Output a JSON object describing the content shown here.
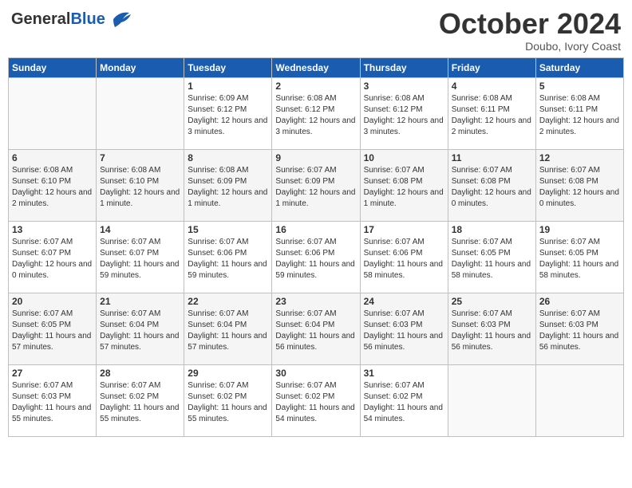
{
  "logo": {
    "text_general": "General",
    "text_blue": "Blue"
  },
  "title": "October 2024",
  "location": "Doubo, Ivory Coast",
  "days_of_week": [
    "Sunday",
    "Monday",
    "Tuesday",
    "Wednesday",
    "Thursday",
    "Friday",
    "Saturday"
  ],
  "weeks": [
    [
      {
        "day": "",
        "info": ""
      },
      {
        "day": "",
        "info": ""
      },
      {
        "day": "1",
        "info": "Sunrise: 6:09 AM\nSunset: 6:12 PM\nDaylight: 12 hours and 3 minutes."
      },
      {
        "day": "2",
        "info": "Sunrise: 6:08 AM\nSunset: 6:12 PM\nDaylight: 12 hours and 3 minutes."
      },
      {
        "day": "3",
        "info": "Sunrise: 6:08 AM\nSunset: 6:12 PM\nDaylight: 12 hours and 3 minutes."
      },
      {
        "day": "4",
        "info": "Sunrise: 6:08 AM\nSunset: 6:11 PM\nDaylight: 12 hours and 2 minutes."
      },
      {
        "day": "5",
        "info": "Sunrise: 6:08 AM\nSunset: 6:11 PM\nDaylight: 12 hours and 2 minutes."
      }
    ],
    [
      {
        "day": "6",
        "info": "Sunrise: 6:08 AM\nSunset: 6:10 PM\nDaylight: 12 hours and 2 minutes."
      },
      {
        "day": "7",
        "info": "Sunrise: 6:08 AM\nSunset: 6:10 PM\nDaylight: 12 hours and 1 minute."
      },
      {
        "day": "8",
        "info": "Sunrise: 6:08 AM\nSunset: 6:09 PM\nDaylight: 12 hours and 1 minute."
      },
      {
        "day": "9",
        "info": "Sunrise: 6:07 AM\nSunset: 6:09 PM\nDaylight: 12 hours and 1 minute."
      },
      {
        "day": "10",
        "info": "Sunrise: 6:07 AM\nSunset: 6:08 PM\nDaylight: 12 hours and 1 minute."
      },
      {
        "day": "11",
        "info": "Sunrise: 6:07 AM\nSunset: 6:08 PM\nDaylight: 12 hours and 0 minutes."
      },
      {
        "day": "12",
        "info": "Sunrise: 6:07 AM\nSunset: 6:08 PM\nDaylight: 12 hours and 0 minutes."
      }
    ],
    [
      {
        "day": "13",
        "info": "Sunrise: 6:07 AM\nSunset: 6:07 PM\nDaylight: 12 hours and 0 minutes."
      },
      {
        "day": "14",
        "info": "Sunrise: 6:07 AM\nSunset: 6:07 PM\nDaylight: 11 hours and 59 minutes."
      },
      {
        "day": "15",
        "info": "Sunrise: 6:07 AM\nSunset: 6:06 PM\nDaylight: 11 hours and 59 minutes."
      },
      {
        "day": "16",
        "info": "Sunrise: 6:07 AM\nSunset: 6:06 PM\nDaylight: 11 hours and 59 minutes."
      },
      {
        "day": "17",
        "info": "Sunrise: 6:07 AM\nSunset: 6:06 PM\nDaylight: 11 hours and 58 minutes."
      },
      {
        "day": "18",
        "info": "Sunrise: 6:07 AM\nSunset: 6:05 PM\nDaylight: 11 hours and 58 minutes."
      },
      {
        "day": "19",
        "info": "Sunrise: 6:07 AM\nSunset: 6:05 PM\nDaylight: 11 hours and 58 minutes."
      }
    ],
    [
      {
        "day": "20",
        "info": "Sunrise: 6:07 AM\nSunset: 6:05 PM\nDaylight: 11 hours and 57 minutes."
      },
      {
        "day": "21",
        "info": "Sunrise: 6:07 AM\nSunset: 6:04 PM\nDaylight: 11 hours and 57 minutes."
      },
      {
        "day": "22",
        "info": "Sunrise: 6:07 AM\nSunset: 6:04 PM\nDaylight: 11 hours and 57 minutes."
      },
      {
        "day": "23",
        "info": "Sunrise: 6:07 AM\nSunset: 6:04 PM\nDaylight: 11 hours and 56 minutes."
      },
      {
        "day": "24",
        "info": "Sunrise: 6:07 AM\nSunset: 6:03 PM\nDaylight: 11 hours and 56 minutes."
      },
      {
        "day": "25",
        "info": "Sunrise: 6:07 AM\nSunset: 6:03 PM\nDaylight: 11 hours and 56 minutes."
      },
      {
        "day": "26",
        "info": "Sunrise: 6:07 AM\nSunset: 6:03 PM\nDaylight: 11 hours and 56 minutes."
      }
    ],
    [
      {
        "day": "27",
        "info": "Sunrise: 6:07 AM\nSunset: 6:03 PM\nDaylight: 11 hours and 55 minutes."
      },
      {
        "day": "28",
        "info": "Sunrise: 6:07 AM\nSunset: 6:02 PM\nDaylight: 11 hours and 55 minutes."
      },
      {
        "day": "29",
        "info": "Sunrise: 6:07 AM\nSunset: 6:02 PM\nDaylight: 11 hours and 55 minutes."
      },
      {
        "day": "30",
        "info": "Sunrise: 6:07 AM\nSunset: 6:02 PM\nDaylight: 11 hours and 54 minutes."
      },
      {
        "day": "31",
        "info": "Sunrise: 6:07 AM\nSunset: 6:02 PM\nDaylight: 11 hours and 54 minutes."
      },
      {
        "day": "",
        "info": ""
      },
      {
        "day": "",
        "info": ""
      }
    ]
  ]
}
